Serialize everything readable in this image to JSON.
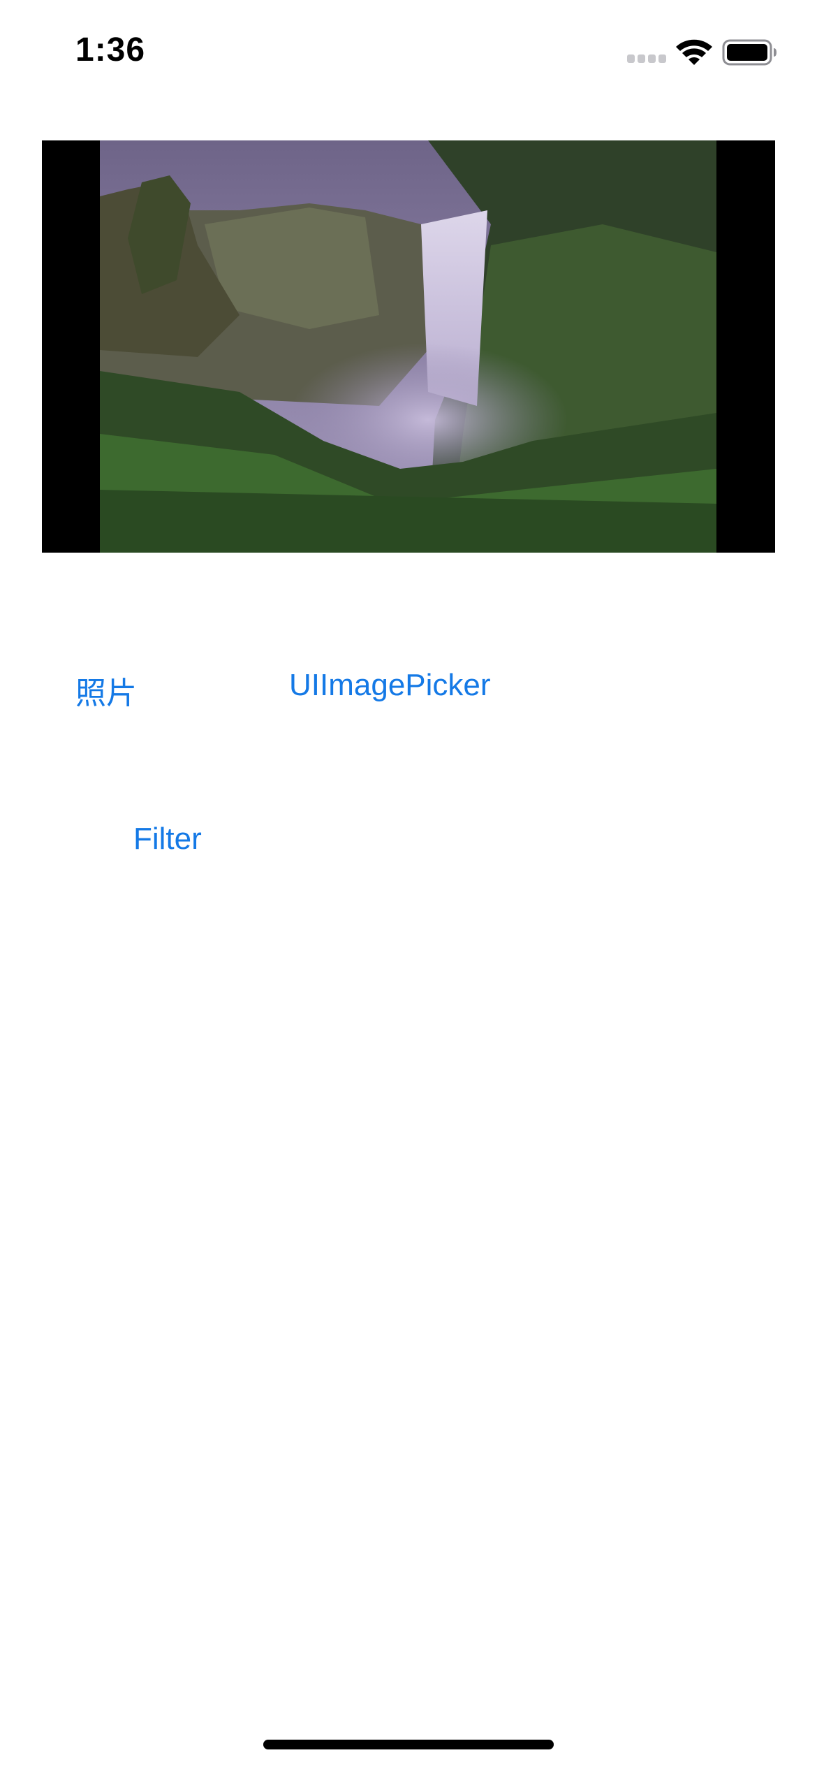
{
  "status_bar": {
    "time": "1:36"
  },
  "image_view": {
    "icon": "waterfall-landscape-photo"
  },
  "buttons": {
    "photos_label": "照片",
    "picker_label": "UIImagePicker",
    "filter_label": "Filter"
  },
  "colors": {
    "accent": "#1479e6",
    "background": "#ffffff"
  }
}
